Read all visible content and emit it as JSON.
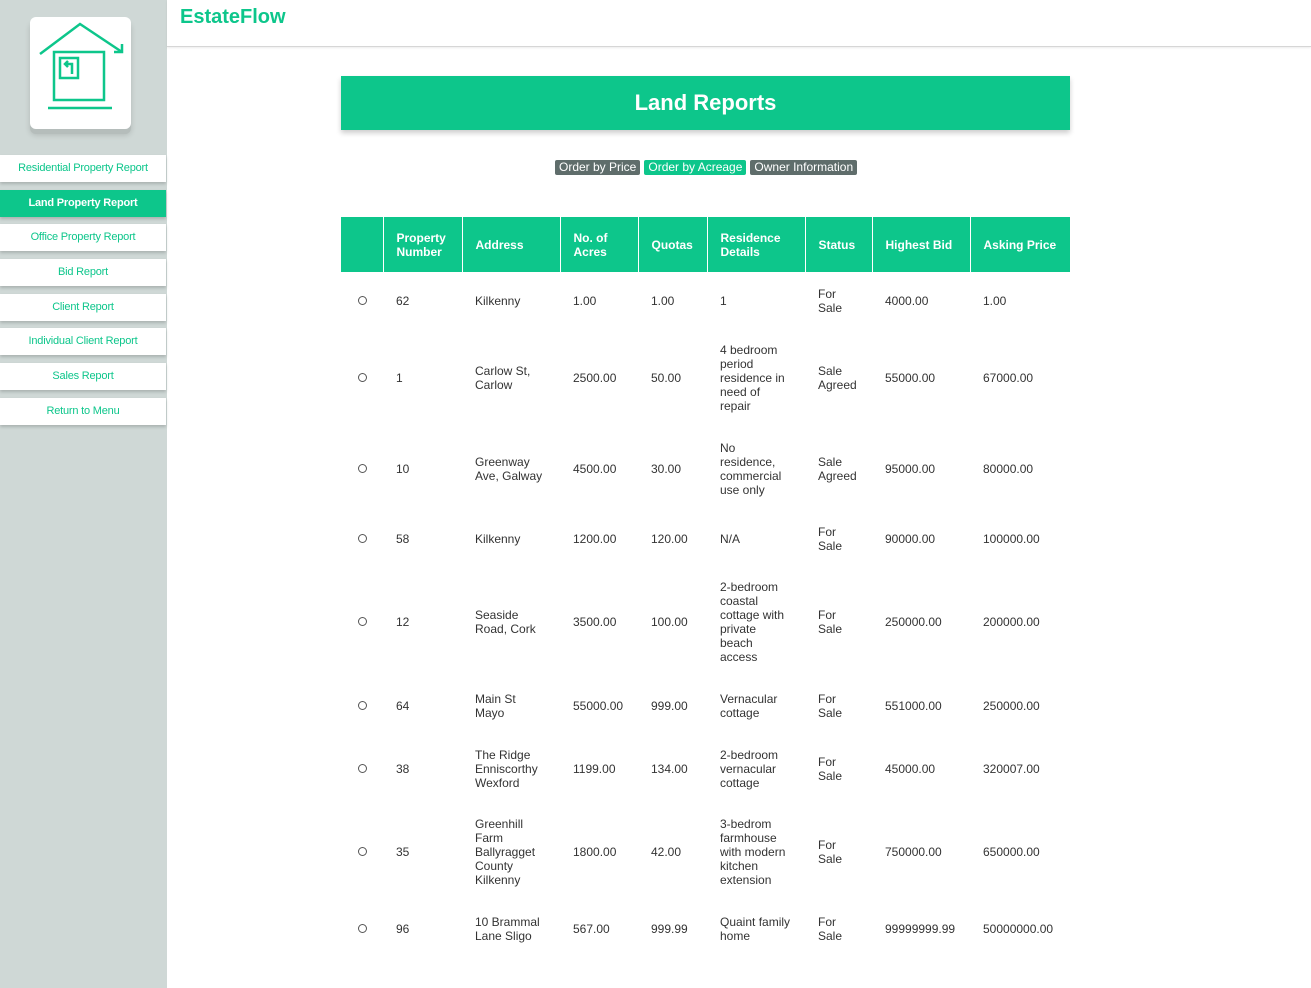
{
  "app": {
    "brand": "EstateFlow",
    "accent_color": "#0dc68b",
    "logo_icon": "house-upload-icon"
  },
  "sidebar": {
    "items": [
      {
        "label": "Residential Property Report",
        "active": false
      },
      {
        "label": "Land Property Report",
        "active": true
      },
      {
        "label": "Office Property Report",
        "active": false
      },
      {
        "label": "Bid Report",
        "active": false
      },
      {
        "label": "Client Report",
        "active": false
      },
      {
        "label": "Individual Client Report",
        "active": false
      },
      {
        "label": "Sales Report",
        "active": false
      },
      {
        "label": "Return to Menu",
        "active": false
      }
    ]
  },
  "main": {
    "title": "Land Reports",
    "buttons": {
      "order_price": "Order by Price",
      "order_acreage": "Order by Acreage",
      "owner_info": "Owner Information"
    },
    "table": {
      "headers": [
        "Property Number",
        "Address",
        "No. of Acres",
        "Quotas",
        "Residence Details",
        "Status",
        "Highest Bid",
        "Asking Price"
      ],
      "rows": [
        [
          "62",
          "Kilkenny",
          "1.00",
          "1.00",
          "1",
          "For Sale",
          "4000.00",
          "1.00"
        ],
        [
          "1",
          "Carlow St, Carlow",
          "2500.00",
          "50.00",
          "4 bedroom period residence in need of repair",
          "Sale Agreed",
          "55000.00",
          "67000.00"
        ],
        [
          "10",
          "Greenway Ave, Galway",
          "4500.00",
          "30.00",
          "No residence, commercial use only",
          "Sale Agreed",
          "95000.00",
          "80000.00"
        ],
        [
          "58",
          "Kilkenny",
          "1200.00",
          "120.00",
          "N/A",
          "For Sale",
          "90000.00",
          "100000.00"
        ],
        [
          "12",
          "Seaside Road, Cork",
          "3500.00",
          "100.00",
          "2-bedroom coastal cottage with private beach access",
          "For Sale",
          "250000.00",
          "200000.00"
        ],
        [
          "64",
          "Main St Mayo",
          "55000.00",
          "999.00",
          "Vernacular cottage",
          "For Sale",
          "551000.00",
          "250000.00"
        ],
        [
          "38",
          "The Ridge Enniscorthy Wexford",
          "1199.00",
          "134.00",
          "2-bedroom vernacular cottage",
          "For Sale",
          "45000.00",
          "320007.00"
        ],
        [
          "35",
          "Greenhill Farm Ballyragget County Kilkenny",
          "1800.00",
          "42.00",
          "3-bedrom farmhouse with modern kitchen extension",
          "For Sale",
          "750000.00",
          "650000.00"
        ],
        [
          "96",
          "10 Brammal Lane Sligo",
          "567.00",
          "999.99",
          "Quaint family home",
          "For Sale",
          "99999999.99",
          "50000000.00"
        ]
      ]
    }
  }
}
